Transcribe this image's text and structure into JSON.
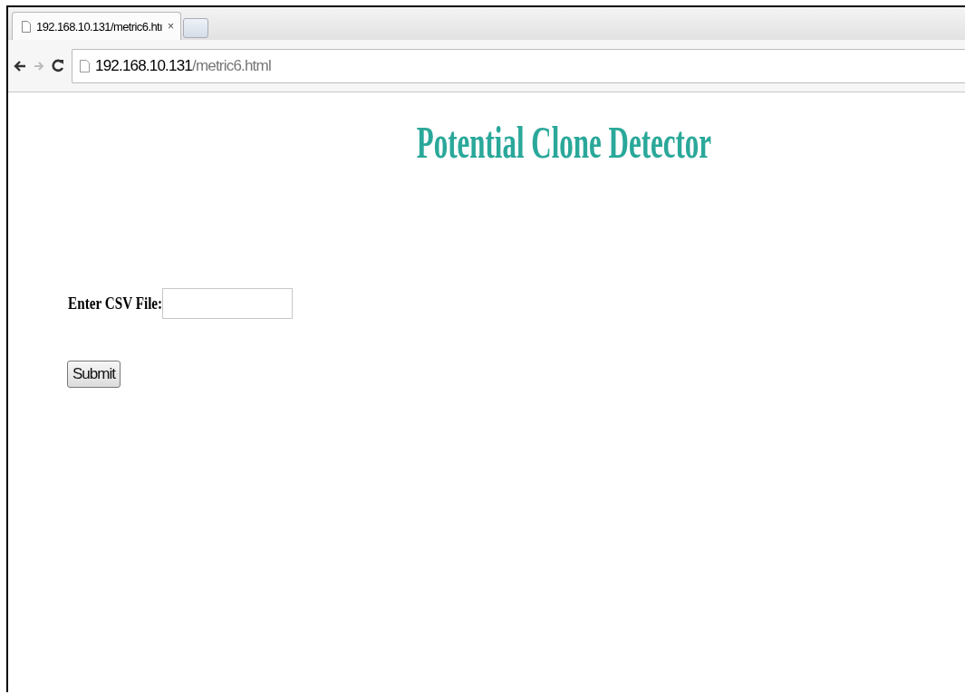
{
  "tab": {
    "title": "192.168.10.131/metric6.htı",
    "close": "×",
    "selected": true
  },
  "address_bar": {
    "host": "192.168.10.131",
    "path": "/metric6.html"
  },
  "page": {
    "heading": "Potential Clone Detector",
    "form": {
      "label": "Enter CSV File:",
      "button": "Submit"
    }
  }
}
